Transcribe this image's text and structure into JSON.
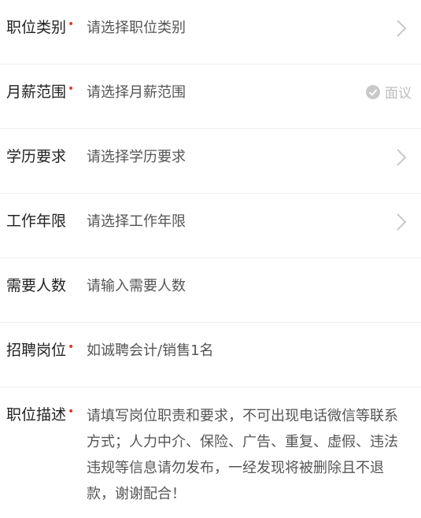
{
  "form": {
    "fields": [
      {
        "label": "职位类别",
        "required": "•",
        "value": "请选择职位类别"
      },
      {
        "label": "月薪范围",
        "required": "•",
        "value": "请选择月薪范围",
        "negotiable": "面议"
      },
      {
        "label": "学历要求",
        "value": "请选择学历要求"
      },
      {
        "label": "工作年限",
        "value": "请选择工作年限"
      },
      {
        "label": "需要人数",
        "value": "请输入需要人数"
      },
      {
        "label": "招聘岗位",
        "required": "•",
        "value": "如诚聘会计/销售1名"
      },
      {
        "label": "职位描述",
        "required": "•",
        "value": "请填写岗位职责和要求，不可出现电话微信等联系方式；人力中介、保险、广告、重复、虚假、违法违规等信息请勿发布，一经发现将被删除且不退款，谢谢配合！"
      }
    ]
  },
  "icons": {
    "chevron": "chevron-right-icon",
    "check": "check-circle-icon"
  },
  "colors": {
    "required": "#e5372b",
    "label": "#222222",
    "placeholder": "#555555",
    "muted": "#bdbdbd",
    "divider": "#f0f0f0"
  }
}
